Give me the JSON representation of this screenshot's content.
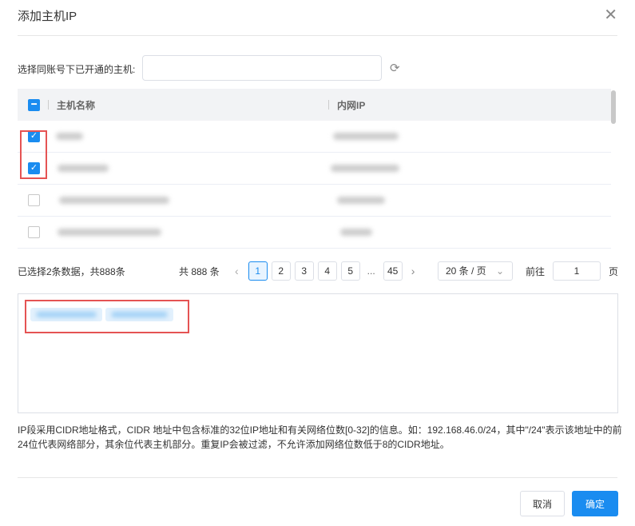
{
  "dialog": {
    "title": "添加主机IP",
    "close_icon": "close-icon"
  },
  "search": {
    "label": "选择同账号下已开通的主机:",
    "value": "",
    "placeholder": ""
  },
  "table": {
    "columns": [
      "主机名称",
      "内网IP"
    ],
    "rows": [
      {
        "checked": true
      },
      {
        "checked": true
      },
      {
        "checked": false
      },
      {
        "checked": false
      }
    ]
  },
  "status": {
    "selected": "已选择2条数据，共888条"
  },
  "pagination": {
    "total": "共 888 条",
    "pages": [
      "1",
      "2",
      "3",
      "4",
      "5"
    ],
    "ellipsis": "...",
    "last": "45",
    "current": "1",
    "page_size": "20 条 / 页",
    "goto_label": "前往",
    "goto_value": "1",
    "page_suffix": "页"
  },
  "hint": "IP段采用CIDR地址格式，CIDR 地址中包含标准的32位IP地址和有关网络位数[0-32]的信息。如：192.168.46.0/24，其中\"/24\"表示该地址中的前24位代表网络部分，其余位代表主机部分。重复IP会被过滤，不允许添加网络位数低于8的CIDR地址。",
  "footer": {
    "cancel": "取消",
    "confirm": "确定"
  },
  "colors": {
    "primary": "#1a8cf0",
    "highlight": "#e55353"
  }
}
